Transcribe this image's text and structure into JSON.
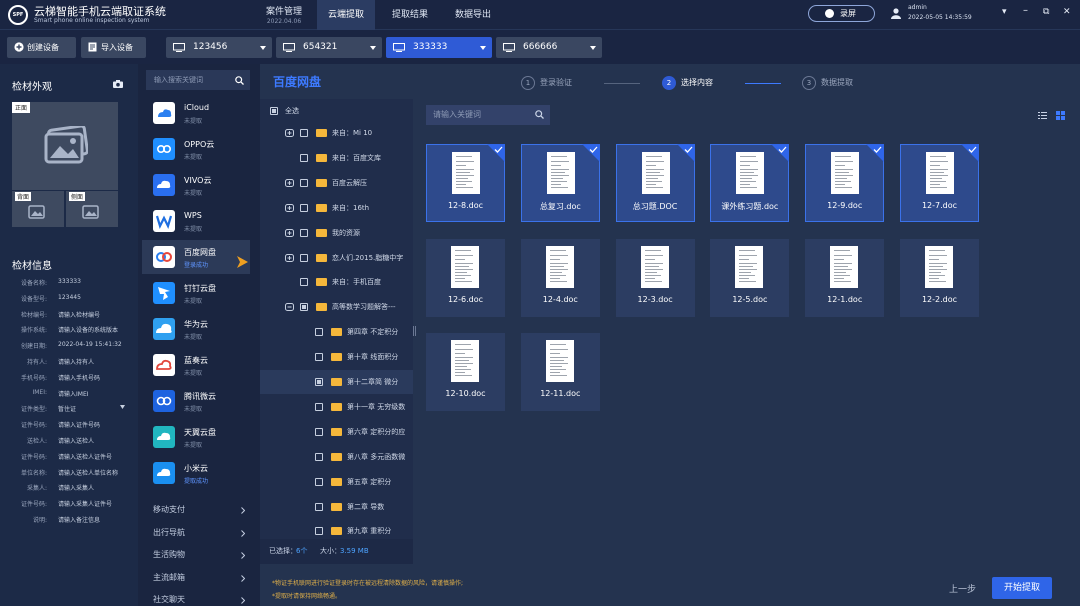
{
  "app": {
    "logo_text": "SPF",
    "title": "云梯智能手机云端取证系统",
    "subtitle": "Smart phone online inspection system"
  },
  "nav": {
    "case": "案件管理",
    "case_date": "2022.04.06",
    "cloud": "云端提取",
    "result": "提取结果",
    "export": "数据导出"
  },
  "header": {
    "record_label": "录屏",
    "user": "admin",
    "time": "2022-05-05 14:35:59",
    "win_menu": "▾",
    "win_min": "–",
    "win_restore": "⧉",
    "win_close": "✕"
  },
  "toolbar": {
    "create": "创建设备",
    "import": "导入设备"
  },
  "devices": [
    "123456",
    "654321",
    "333333",
    "666666"
  ],
  "left": {
    "appearance_title": "检材外观",
    "front": "正面",
    "back": "背面",
    "side": "侧面",
    "info_title": "检材信息",
    "fields": [
      {
        "k": "设备名称:",
        "v": "333333"
      },
      {
        "k": "设备型号:",
        "v": "123445"
      },
      {
        "k": "检材编号:",
        "v": "请输入检材编号"
      },
      {
        "k": "操作系统:",
        "v": "请输入设备的系统版本"
      },
      {
        "k": "创建日期:",
        "v": "2022-04-19 15:41:32"
      },
      {
        "k": "持有人:",
        "v": "请输入持有人"
      },
      {
        "k": "手机号码:",
        "v": "请输入手机号码"
      },
      {
        "k": "IMEI:",
        "v": "请输入IMEI"
      },
      {
        "k": "证件类型:",
        "v": "暂住证"
      },
      {
        "k": "证件号码:",
        "v": "请输入证件号码"
      },
      {
        "k": "送检人:",
        "v": "请输入送检人"
      },
      {
        "k": "证件号码:",
        "v": "请输入送检人证件号"
      },
      {
        "k": "单位名称:",
        "v": "请输入送检人单位名称"
      },
      {
        "k": "采集人:",
        "v": "请输入采集人"
      },
      {
        "k": "证件号码:",
        "v": "请输入采集人证件号"
      },
      {
        "k": "说明:",
        "v": "请输入备注信息"
      }
    ]
  },
  "sources": {
    "search_placeholder": "输入搜索关键词",
    "items": [
      {
        "name": "iCloud",
        "status": "未提取"
      },
      {
        "name": "OPPO云",
        "status": "未提取"
      },
      {
        "name": "VIVO云",
        "status": "未提取"
      },
      {
        "name": "WPS",
        "status": "未提取"
      },
      {
        "name": "百度网盘",
        "status": "登录成功"
      },
      {
        "name": "钉钉云盘",
        "status": "未提取"
      },
      {
        "name": "华为云",
        "status": "未提取"
      },
      {
        "name": "蓝奏云",
        "status": "未提取"
      },
      {
        "name": "腾讯微云",
        "status": "未提取"
      },
      {
        "name": "天翼云盘",
        "status": "未提取"
      },
      {
        "name": "小米云",
        "status": "提取成功"
      }
    ],
    "categories": [
      "移动支付",
      "出行导航",
      "生活购物",
      "主流邮箱",
      "社交聊天"
    ]
  },
  "main": {
    "pane_title": "百度网盘",
    "steps": [
      {
        "n": "1",
        "label": "登录验证"
      },
      {
        "n": "2",
        "label": "选择内容"
      },
      {
        "n": "3",
        "label": "数据提取"
      }
    ],
    "file_search_placeholder": "请输入关键词"
  },
  "tree": {
    "select_all": "全选",
    "nodes": [
      "来自：Mi 10",
      "来自：百度文库",
      "百度云解压",
      "来自：16th",
      "我的资源",
      "恋人们.2015.脂糖中字",
      "来自：手机百度",
      "高等数学习题解答---",
      "第四章 不定积分",
      "第十章 线面积分",
      "第十二章简 微分",
      "第十一章 无穷级数",
      "第六章 定积分的应用",
      "第八章 多元函数微分",
      "第五章 定积分",
      "第二章 导数",
      "第九章 重积分"
    ],
    "selected_label": "已选择：",
    "selected_count": "6个",
    "size_label": "大小：",
    "size_value": "3.59 MB"
  },
  "files": [
    "12-8.doc",
    "总复习.doc",
    "总习题.DOC",
    "课外练习题.doc",
    "12-9.doc",
    "12-7.doc",
    "12-6.doc",
    "12-4.doc",
    "12-3.doc",
    "12-5.doc",
    "12-1.doc",
    "12-2.doc",
    "12-10.doc",
    "12-11.doc"
  ],
  "footer": {
    "notice1": "*物证手机联网进行验证登录时存在被远程清除数据的风险，请谨慎操作;",
    "notice2": "*提取时请保持网络畅通。",
    "prev": "上一步",
    "start": "开始提取"
  },
  "colors": {
    "accent": "#2f65e8",
    "title_blue": "#3d7aff",
    "warning": "#e0b04a",
    "folder": "#f5b73b"
  }
}
